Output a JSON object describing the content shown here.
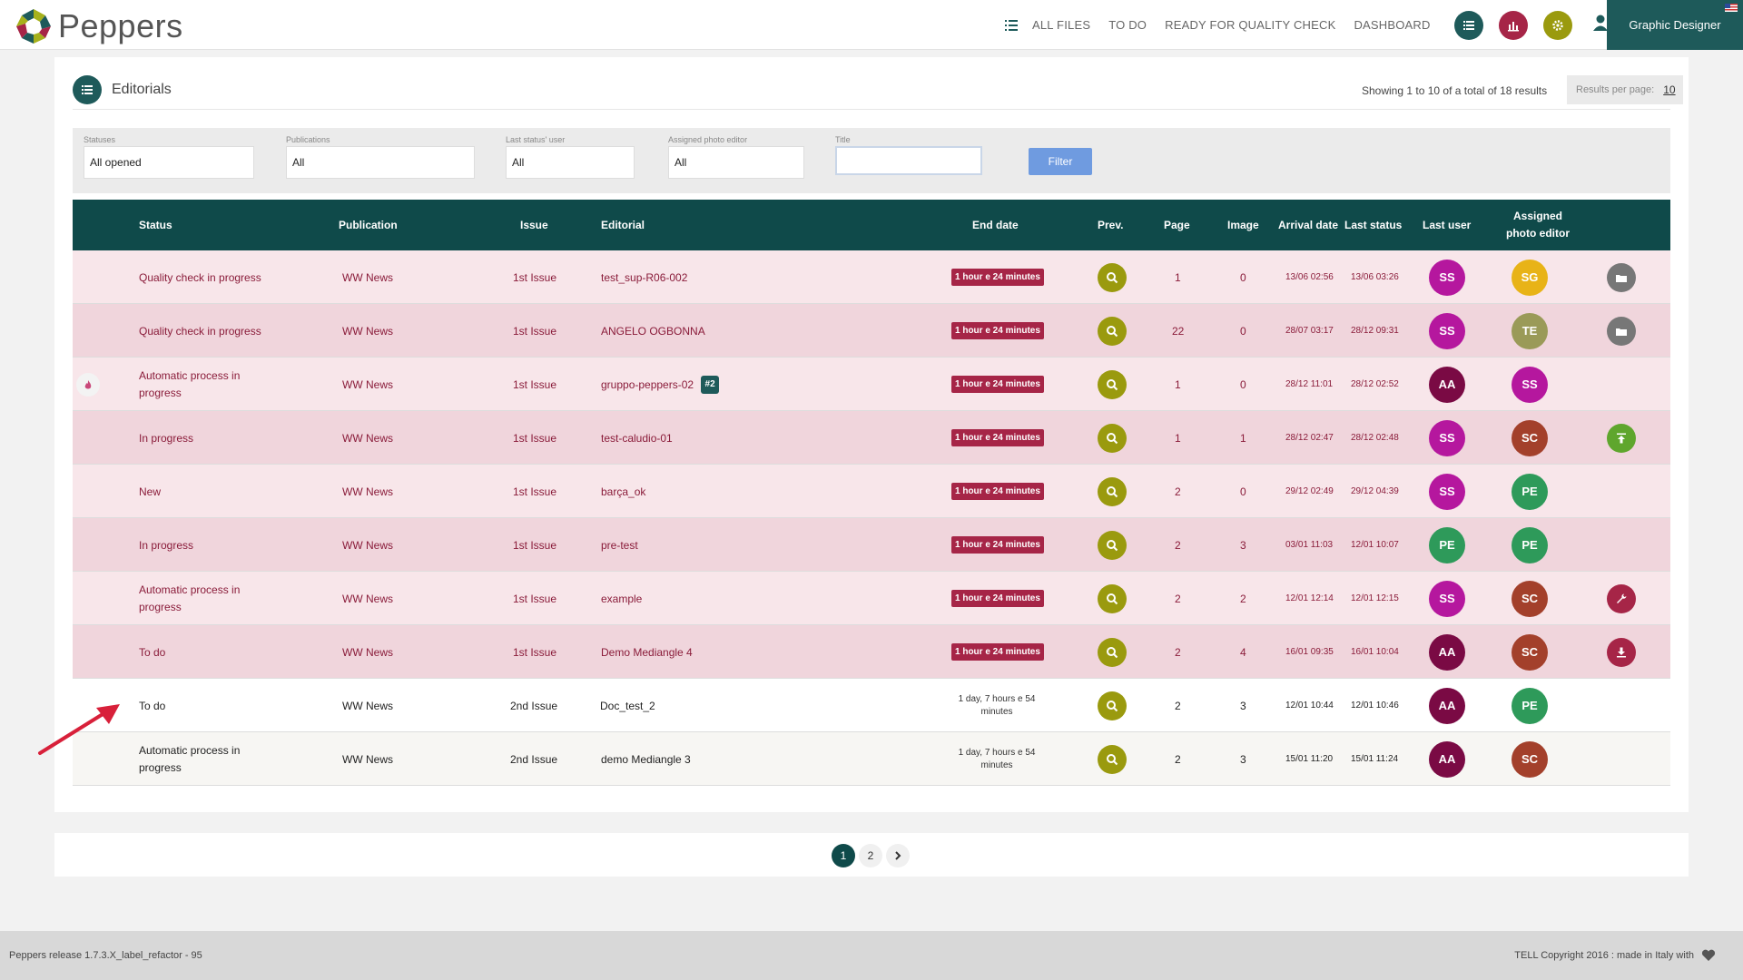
{
  "app": {
    "name": "Peppers"
  },
  "nav": {
    "items": [
      "ALL FILES",
      "TO DO",
      "READY FOR QUALITY CHECK",
      "DASHBOARD"
    ]
  },
  "user": {
    "role": "Graphic Designer"
  },
  "colors": {
    "primary": "#0f4a4a",
    "accent_red": "#a62547",
    "olive": "#9a9a0e",
    "filter_btn": "#6f9be0"
  },
  "panel": {
    "title": "Editorials",
    "showing": "Showing 1 to 10 of a total of 18 results",
    "rpp_label": "Results per page:",
    "rpp_value": "10"
  },
  "filters": {
    "statuses": {
      "label": "Statuses",
      "value": "All opened"
    },
    "publications": {
      "label": "Publications",
      "value": "All"
    },
    "last_status_user": {
      "label": "Last status' user",
      "value": "All"
    },
    "photo_editor": {
      "label": "Assigned photo editor",
      "value": "All"
    },
    "title": {
      "label": "Title",
      "value": ""
    },
    "button": "Filter"
  },
  "table": {
    "headers": {
      "status": "Status",
      "publication": "Publication",
      "issue": "Issue",
      "editorial": "Editorial",
      "end_date": "End date",
      "prev": "Prev.",
      "page": "Page",
      "image": "Image",
      "arrival": "Arrival date",
      "last_status": "Last status",
      "last_user": "Last user",
      "photo_editor_1": "Assigned",
      "photo_editor_2": "photo editor"
    },
    "rows": [
      {
        "status": "Quality check in progress",
        "publication": "WW News",
        "issue": "1st Issue",
        "editorial": "test_sup-R06-002",
        "end_date": "1 hour e 24 minutes",
        "page": "1",
        "image": "0",
        "arrival": "13/06 02:56",
        "last_status": "13/06 03:26",
        "last_user": "SS",
        "editor": "SG",
        "action": "folder-icon"
      },
      {
        "status": "Quality check in progress",
        "publication": "WW News",
        "issue": "1st Issue",
        "editorial": "ANGELO OGBONNA",
        "end_date": "1 hour e 24 minutes",
        "page": "22",
        "image": "0",
        "arrival": "28/07 03:17",
        "last_status": "28/12 09:31",
        "last_user": "SS",
        "editor": "TE",
        "action": "folder-icon"
      },
      {
        "status": "Automatic process in progress",
        "publication": "WW News",
        "issue": "1st Issue",
        "editorial": "gruppo-peppers-02",
        "tag": "#2",
        "end_date": "1 hour e 24 minutes",
        "page": "1",
        "image": "0",
        "arrival": "28/12 11:01",
        "last_status": "28/12 02:52",
        "last_user": "AA",
        "editor": "SS",
        "action": ""
      },
      {
        "status": "In progress",
        "publication": "WW News",
        "issue": "1st Issue",
        "editorial": "test-caludio-01",
        "end_date": "1 hour e 24 minutes",
        "page": "1",
        "image": "1",
        "arrival": "28/12 02:47",
        "last_status": "28/12 02:48",
        "last_user": "SS",
        "editor": "SC",
        "action": "upload-icon"
      },
      {
        "status": "New",
        "publication": "WW News",
        "issue": "1st Issue",
        "editorial": "barça_ok",
        "end_date": "1 hour e 24 minutes",
        "page": "2",
        "image": "0",
        "arrival": "29/12 02:49",
        "last_status": "29/12 04:39",
        "last_user": "SS",
        "editor": "PE",
        "action": ""
      },
      {
        "status": "In progress",
        "publication": "WW News",
        "issue": "1st Issue",
        "editorial": "pre-test",
        "end_date": "1 hour e 24 minutes",
        "page": "2",
        "image": "3",
        "arrival": "03/01 11:03",
        "last_status": "12/01 10:07",
        "last_user": "PE",
        "editor": "PE",
        "action": ""
      },
      {
        "status": "Automatic process in progress",
        "publication": "WW News",
        "issue": "1st Issue",
        "editorial": "example",
        "end_date": "1 hour e 24 minutes",
        "page": "2",
        "image": "2",
        "arrival": "12/01 12:14",
        "last_status": "12/01 12:15",
        "last_user": "SS",
        "editor": "SC",
        "action": "wrench-icon"
      },
      {
        "status": "To do",
        "publication": "WW News",
        "issue": "1st Issue",
        "editorial": "Demo Mediangle 4",
        "end_date": "1 hour e 24 minutes",
        "page": "2",
        "image": "4",
        "arrival": "16/01 09:35",
        "last_status": "16/01 10:04",
        "last_user": "AA",
        "editor": "SC",
        "action": "download-icon"
      },
      {
        "status": "To do",
        "publication": "WW News",
        "issue": "2nd Issue",
        "editorial": "Doc_test_2",
        "end_date": "1 day, 7 hours e 54 minutes",
        "page": "2",
        "image": "3",
        "arrival": "12/01 10:44",
        "last_status": "12/01 10:46",
        "last_user": "AA",
        "editor": "PE",
        "action": ""
      },
      {
        "status": "Automatic process in progress",
        "publication": "WW News",
        "issue": "2nd Issue",
        "editorial": "demo Mediangle 3",
        "end_date": "1 day, 7 hours e 54 minutes",
        "page": "2",
        "image": "3",
        "arrival": "15/01 11:20",
        "last_status": "15/01 11:24",
        "last_user": "AA",
        "editor": "SC",
        "action": ""
      }
    ]
  },
  "pagination": {
    "pages": [
      "1",
      "2"
    ],
    "current": "1"
  },
  "footer": {
    "release": "Peppers release 1.7.3.X_label_refactor - 95",
    "copyright": "TELL Copyright 2016 : made in Italy with"
  }
}
